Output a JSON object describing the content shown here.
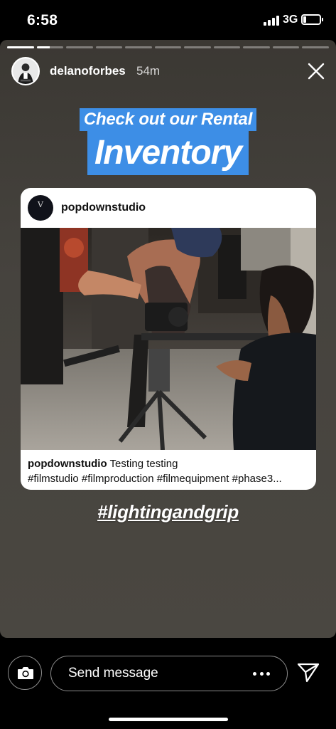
{
  "status_bar": {
    "time": "6:58",
    "network": "3G",
    "battery_level": 0.2
  },
  "story": {
    "progress_segments": [
      1,
      0.5,
      0,
      0,
      0,
      0,
      0,
      0,
      0,
      0,
      0
    ],
    "user": {
      "username": "delanoforbes",
      "time_ago": "54m"
    },
    "headline_small": "Check out our Rental",
    "headline_large": "Inventory",
    "shared_post": {
      "username": "popdownstudio",
      "avatar_letter": "V",
      "caption_user": "popdownstudio",
      "caption_text": "Testing testing",
      "hashtags": "#filmstudio #filmproduction #filmequipment #phase3..."
    },
    "hashtag_sticker": "#lightingandgrip"
  },
  "bottom_bar": {
    "message_placeholder": "Send message"
  },
  "colors": {
    "sticker_blue": "#3d8ee6",
    "story_bg": "#46433e"
  },
  "icons": [
    "close-icon",
    "camera-icon",
    "more-icon",
    "send-icon"
  ]
}
